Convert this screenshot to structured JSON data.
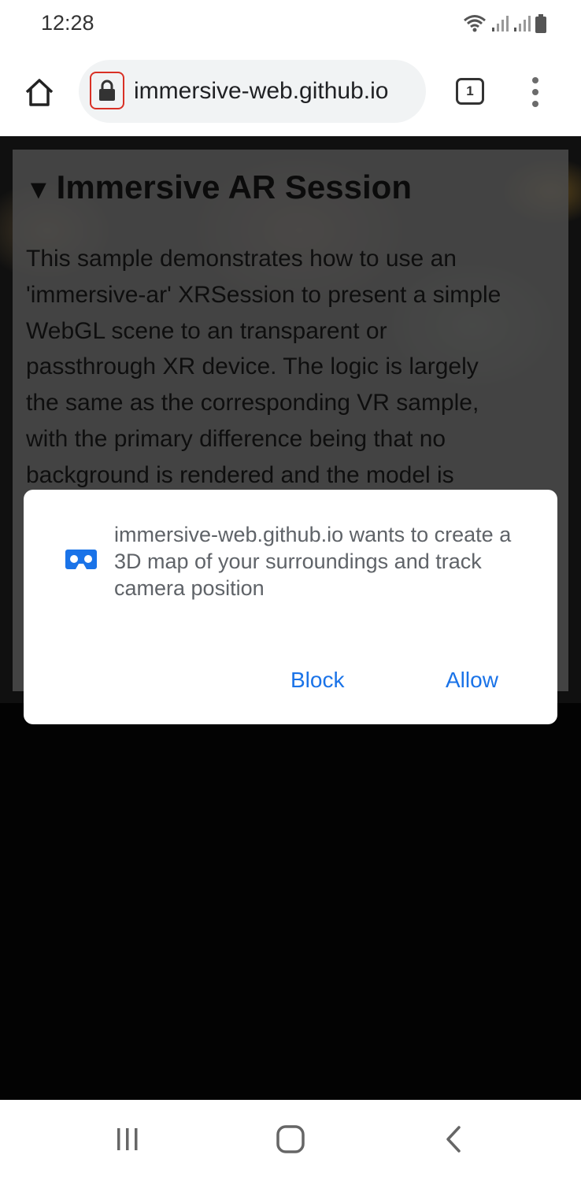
{
  "status_bar": {
    "time": "12:28",
    "icons": [
      "wifi-icon",
      "signal-icon",
      "signal-icon",
      "battery-icon"
    ]
  },
  "toolbar": {
    "url": "immersive-web.github.io",
    "tab_count": "1",
    "home_icon": "home-icon",
    "lock_icon": "lock-icon",
    "menu_icon": "more-vert-icon"
  },
  "page": {
    "heading_marker": "▼",
    "heading": "Immersive AR Session",
    "body_lines": [
      "This sample demonstrates how to use an",
      "'immersive-ar' XRSession to present a simple",
      "WebGL scene to an transparent or",
      "passthrough XR device. The logic is largely",
      "the same as the corresponding VR sample,",
      "with the primary difference being that no",
      "background is rendered and the model is"
    ]
  },
  "dialog": {
    "icon": "vr-headset-icon",
    "message": "immersive-web.github.io wants to create a 3D map of your surroundings and track camera position",
    "block_label": "Block",
    "allow_label": "Allow"
  },
  "nav_bar": {
    "recents_icon": "recents-icon",
    "home_icon": "home-icon",
    "back_icon": "back-icon"
  },
  "colors": {
    "accent": "#1a73e8",
    "lock_outline": "#d93025",
    "panel_bg": "#737373"
  }
}
